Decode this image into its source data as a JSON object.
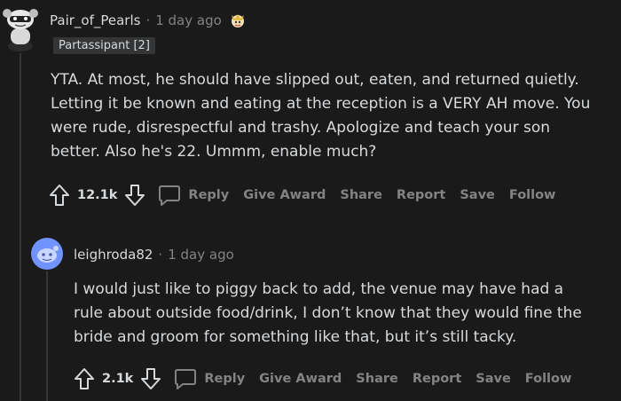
{
  "comment1": {
    "username": "Pair_of_Pearls",
    "separator": "·",
    "time": "1 day ago",
    "flair": "Partassipant [2]",
    "body_lines": [
      "YTA. At most, he should have slipped out, eaten, and returned quietly.",
      "Letting it be known and eating at the reception is a VERY AH move. You",
      "were rude, disrespectful and trashy. Apologize and teach your son",
      "better. Also he's 22. Ummm, enable much?"
    ],
    "score": "12.1k",
    "actions": {
      "reply": "Reply",
      "give_award": "Give Award",
      "share": "Share",
      "report": "Report",
      "save": "Save",
      "follow": "Follow"
    }
  },
  "comment2": {
    "username": "leighroda82",
    "separator": "·",
    "time": "1 day ago",
    "body_lines": [
      "I would just like to piggy back to add, the venue may have had a",
      "rule about outside food/drink, I don’t know that they would fine the",
      "bride and groom for something like that, but it’s still tacky."
    ],
    "score": "2.1k",
    "actions": {
      "reply": "Reply",
      "give_award": "Give Award",
      "share": "Share",
      "report": "Report",
      "save": "Save",
      "follow": "Follow"
    }
  },
  "icons": {
    "avatar1": "snoo-avatar-icon",
    "avatar2": "snoo-avatar-icon",
    "award": "award-badge-icon",
    "upvote": "arrow-up-icon",
    "downvote": "arrow-down-icon",
    "reply": "speech-bubble-icon"
  },
  "colors": {
    "background": "#1a1a1b",
    "text": "#d7dadc",
    "muted": "#818384",
    "avatar2_bg": "#7193ff"
  }
}
